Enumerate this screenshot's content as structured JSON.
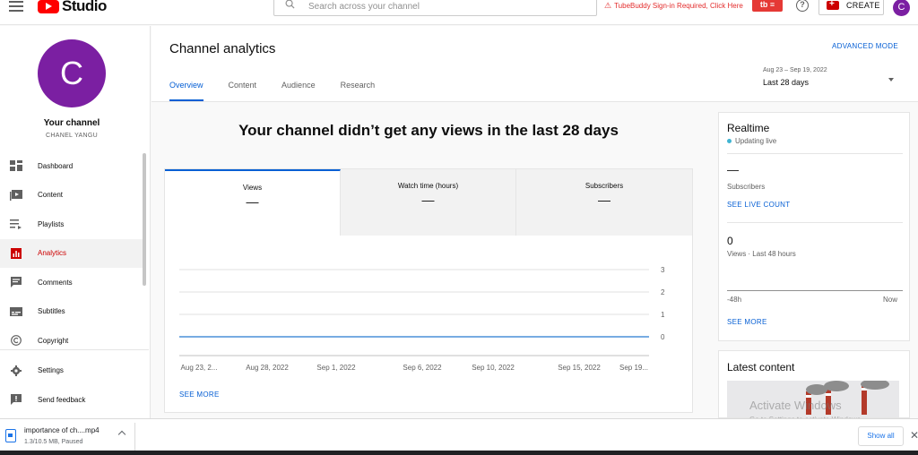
{
  "topbar": {
    "logo_text": "Studio",
    "search_placeholder": "Search across your channel",
    "tubebuddy_notice": "TubeBuddy Sign-in Required, Click Here",
    "create_label": "CREATE",
    "avatar_initial": "C"
  },
  "sidebar": {
    "avatar_initial": "C",
    "your_channel": "Your channel",
    "channel_name": "CHANEL YANGU",
    "items": [
      {
        "label": "Dashboard",
        "icon": "dashboard-icon"
      },
      {
        "label": "Content",
        "icon": "content-icon"
      },
      {
        "label": "Playlists",
        "icon": "playlists-icon"
      },
      {
        "label": "Analytics",
        "icon": "analytics-icon",
        "active": true
      },
      {
        "label": "Comments",
        "icon": "comments-icon"
      },
      {
        "label": "Subtitles",
        "icon": "subtitles-icon"
      },
      {
        "label": "Copyright",
        "icon": "copyright-icon"
      },
      {
        "label": "Settings",
        "icon": "settings-icon"
      },
      {
        "label": "Send feedback",
        "icon": "feedback-icon"
      }
    ]
  },
  "header": {
    "title": "Channel analytics",
    "advanced_mode": "ADVANCED MODE",
    "tabs": [
      "Overview",
      "Content",
      "Audience",
      "Research"
    ],
    "active_tab": "Overview",
    "date_sub": "Aug 23 – Sep 19, 2022",
    "date_main": "Last 28 days"
  },
  "main": {
    "headline": "Your channel didn’t get any views in the last 28 days",
    "metrics": [
      {
        "label": "Views",
        "value": "—"
      },
      {
        "label": "Watch time (hours)",
        "value": "—"
      },
      {
        "label": "Subscribers",
        "value": "—"
      }
    ],
    "see_more": "SEE MORE"
  },
  "chart_data": {
    "type": "line",
    "x": [
      "Aug 23, 2...",
      "Aug 28, 2022",
      "Sep 1, 2022",
      "Sep 6, 2022",
      "Sep 10, 2022",
      "Sep 15, 2022",
      "Sep 19..."
    ],
    "series": [
      {
        "values": [
          0,
          0,
          0,
          0,
          0,
          0,
          0
        ]
      }
    ],
    "yticks": [
      "3",
      "2",
      "1",
      "0"
    ],
    "ylim": [
      0,
      3
    ],
    "grid": true,
    "line_color": "#4a90d9"
  },
  "realtime": {
    "title": "Realtime",
    "live": "Updating live",
    "subs_value": "—",
    "subs_label": "Subscribers",
    "live_count": "SEE LIVE COUNT",
    "views_value": "0",
    "views_label": "Views · Last 48 hours",
    "axis_left": "-48h",
    "axis_right": "Now",
    "see_more": "SEE MORE"
  },
  "latest": {
    "title": "Latest content"
  },
  "watermark": {
    "line1": "Activate Windows",
    "line2": "Go to Settings to activate Windows."
  },
  "download": {
    "filename": "importance of ch....mp4",
    "status": "1.3/10.5 MB, Paused",
    "show_all": "Show all"
  },
  "colors": {
    "accent": "#065fd4",
    "brand": "#ff0000",
    "avatar": "#7b1fa2",
    "active_nav": "#cc0000"
  }
}
